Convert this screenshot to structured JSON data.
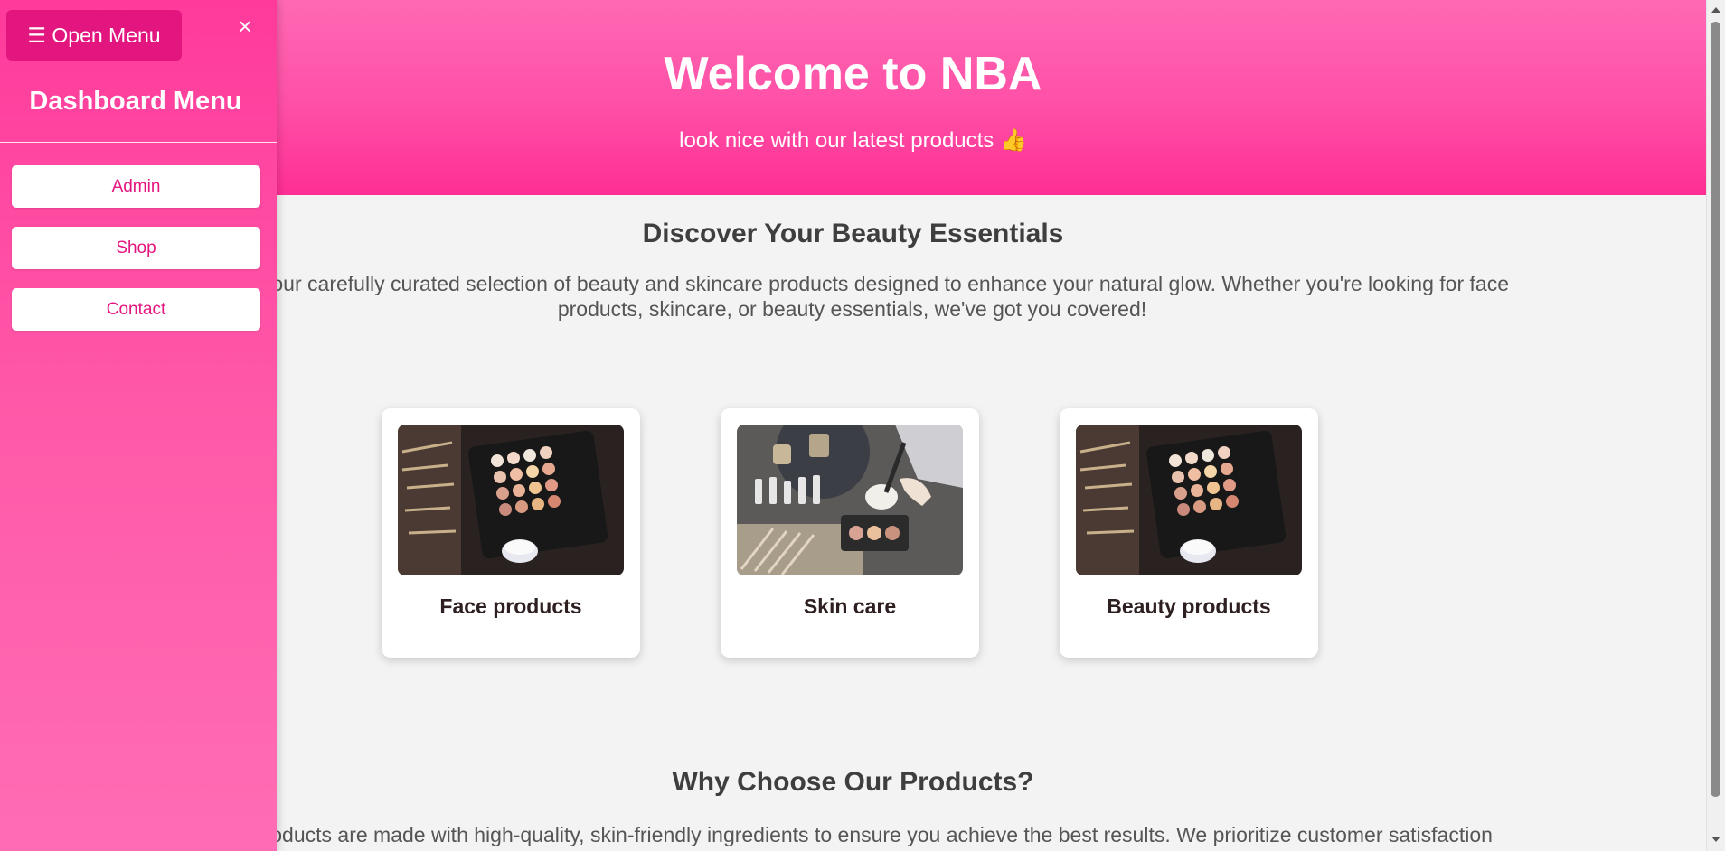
{
  "hero": {
    "title": "Welcome to NBA",
    "subtitle": "look nice with our latest products 👍"
  },
  "section1": {
    "title": "Discover Your Beauty Essentials",
    "text": "Explore our carefully curated selection of beauty and skincare products designed to enhance your natural glow. Whether you're looking for face products, skincare, or beauty essentials, we've got you covered!"
  },
  "cards": [
    {
      "label": "Face products"
    },
    {
      "label": "Skin care"
    },
    {
      "label": "Beauty products"
    }
  ],
  "section2": {
    "title": "Why Choose Our Products?",
    "text": "Our products are made with high-quality, skin-friendly ingredients to ensure you achieve the best results. We prioritize customer satisfaction"
  },
  "sidebar": {
    "open_menu": "☰ Open Menu",
    "close": "×",
    "title": "Dashboard Menu",
    "items": [
      {
        "label": "Admin"
      },
      {
        "label": "Shop"
      },
      {
        "label": "Contact"
      }
    ]
  },
  "colors": {
    "accent": "#ff3a9b",
    "button_dark": "#e3157f",
    "background": "#f3f3f3"
  }
}
